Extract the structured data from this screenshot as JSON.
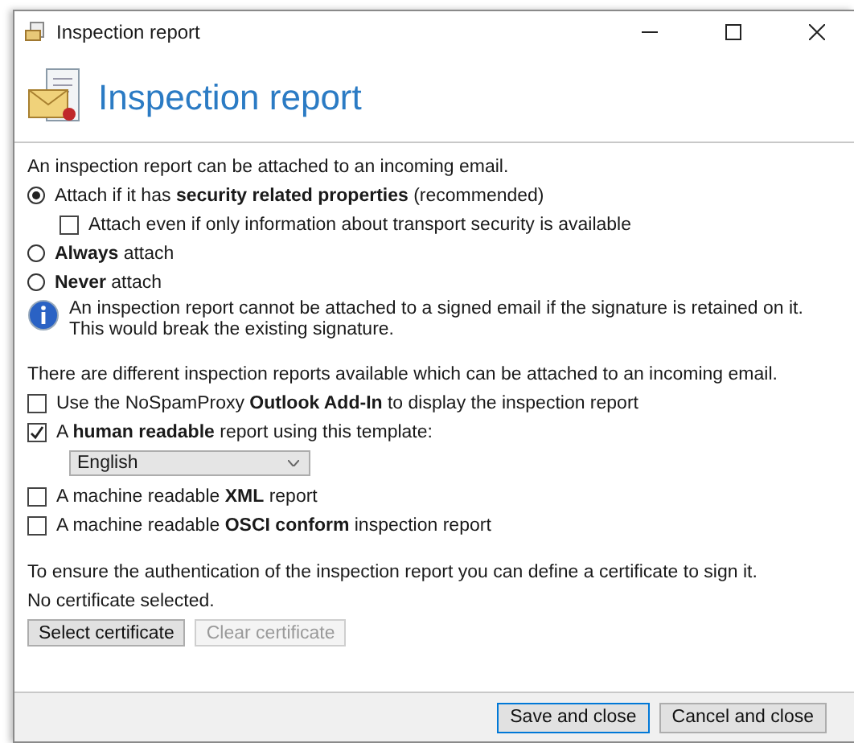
{
  "window": {
    "title": "Inspection report"
  },
  "header": {
    "title": "Inspection report"
  },
  "intro": "An inspection report can be attached to an incoming email.",
  "attach_options": [
    {
      "kind": "radio",
      "label": "Attach if it has **security related properties** (recommended)",
      "selected": true
    },
    {
      "kind": "checkbox",
      "label": "Attach even if only information about transport security is available",
      "checked": false
    },
    {
      "kind": "radio",
      "label": "**Always** attach",
      "selected": false
    },
    {
      "kind": "radio",
      "label": "**Never** attach",
      "selected": false
    }
  ],
  "info": "An inspection report cannot be attached to a signed email if the signature is retained on it. This would break the existing signature.",
  "reports_intro": "There are different inspection reports available which can be attached to an incoming email.",
  "reports": [
    {
      "label": "Use the NoSpamProxy **Outlook Add-In** to display the inspection report",
      "checked": false
    },
    {
      "label": "A **human readable** report using this template:",
      "checked": true,
      "template": "English"
    },
    {
      "label": "A machine readable **XML** report",
      "checked": false
    },
    {
      "label": "A machine readable **OSCI conform** inspection report",
      "checked": false
    }
  ],
  "certificate": {
    "text": "To ensure the authentication of the inspection report you can define a certificate to sign it.",
    "status": "No certificate selected.",
    "buttons": [
      {
        "label": "Select certificate",
        "disabled": false
      },
      {
        "label": "Clear certificate",
        "disabled": true
      }
    ]
  },
  "footer_buttons": [
    {
      "label": "Save and close",
      "selected": true
    },
    {
      "label": "Cancel and close",
      "selected": false
    }
  ]
}
